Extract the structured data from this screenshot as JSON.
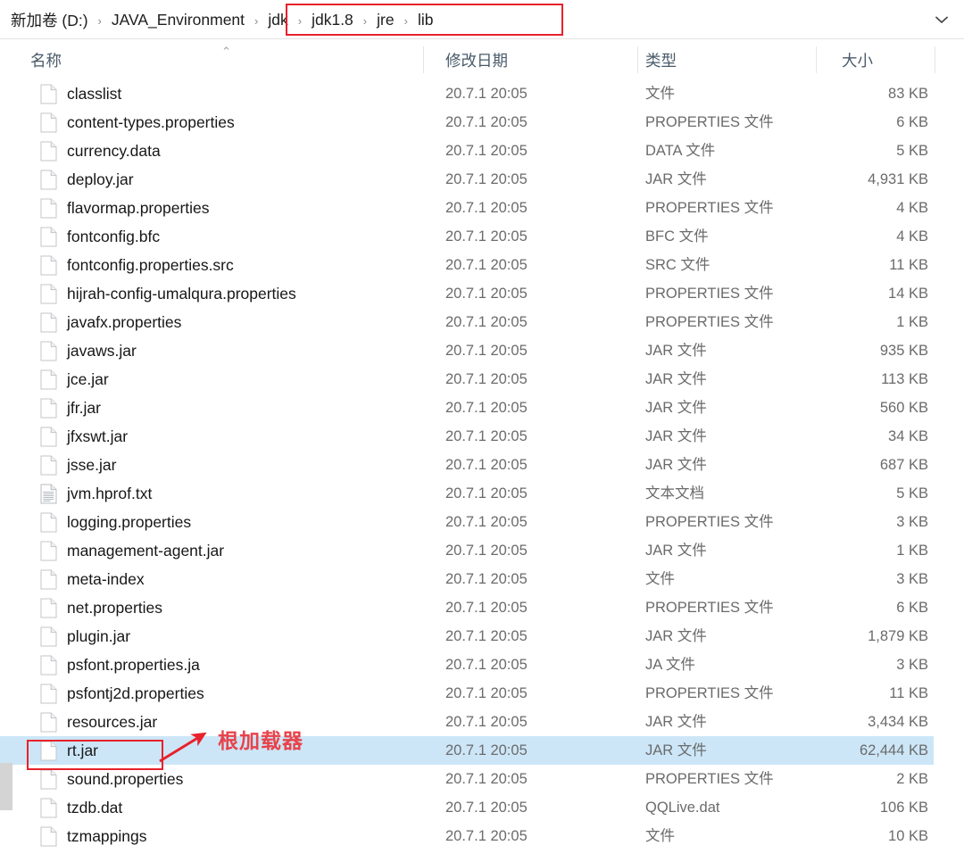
{
  "address_bar": {
    "breadcrumbs": [
      {
        "label": "新加卷 (D:)",
        "highlighted": false
      },
      {
        "label": "JAVA_Environment",
        "highlighted": false
      },
      {
        "label": "jdk",
        "highlighted": true
      },
      {
        "label": "jdk1.8",
        "highlighted": true
      },
      {
        "label": "jre",
        "highlighted": true
      },
      {
        "label": "lib",
        "highlighted": true
      }
    ],
    "separator": "›",
    "dropdown_icon": "chevron-down-icon",
    "highlight_color": "#e8212b"
  },
  "columns": {
    "name": "名称",
    "date_modified": "修改日期",
    "type": "类型",
    "size": "大小",
    "sort_indicator": "⌃",
    "sort_column": "名称",
    "sort_direction": "ascending"
  },
  "annotation": {
    "text": "根加载器",
    "color": "#e8434b",
    "target": "rt.jar",
    "arrow_icon": "arrow-up-right-icon"
  },
  "selection": {
    "selected_file": "rt.jar",
    "highlight_color": "#cce6f7"
  },
  "files": [
    {
      "icon": "blank-file-icon",
      "name": "classlist",
      "date": "20.7.1 20:05",
      "type": "文件",
      "size": "83 KB"
    },
    {
      "icon": "blank-file-icon",
      "name": "content-types.properties",
      "date": "20.7.1 20:05",
      "type": "PROPERTIES 文件",
      "size": "6 KB"
    },
    {
      "icon": "blank-file-icon",
      "name": "currency.data",
      "date": "20.7.1 20:05",
      "type": "DATA 文件",
      "size": "5 KB"
    },
    {
      "icon": "blank-file-icon",
      "name": "deploy.jar",
      "date": "20.7.1 20:05",
      "type": "JAR 文件",
      "size": "4,931 KB"
    },
    {
      "icon": "blank-file-icon",
      "name": "flavormap.properties",
      "date": "20.7.1 20:05",
      "type": "PROPERTIES 文件",
      "size": "4 KB"
    },
    {
      "icon": "blank-file-icon",
      "name": "fontconfig.bfc",
      "date": "20.7.1 20:05",
      "type": "BFC 文件",
      "size": "4 KB"
    },
    {
      "icon": "blank-file-icon",
      "name": "fontconfig.properties.src",
      "date": "20.7.1 20:05",
      "type": "SRC 文件",
      "size": "11 KB"
    },
    {
      "icon": "blank-file-icon",
      "name": "hijrah-config-umalqura.properties",
      "date": "20.7.1 20:05",
      "type": "PROPERTIES 文件",
      "size": "14 KB"
    },
    {
      "icon": "blank-file-icon",
      "name": "javafx.properties",
      "date": "20.7.1 20:05",
      "type": "PROPERTIES 文件",
      "size": "1 KB"
    },
    {
      "icon": "blank-file-icon",
      "name": "javaws.jar",
      "date": "20.7.1 20:05",
      "type": "JAR 文件",
      "size": "935 KB"
    },
    {
      "icon": "blank-file-icon",
      "name": "jce.jar",
      "date": "20.7.1 20:05",
      "type": "JAR 文件",
      "size": "113 KB"
    },
    {
      "icon": "blank-file-icon",
      "name": "jfr.jar",
      "date": "20.7.1 20:05",
      "type": "JAR 文件",
      "size": "560 KB"
    },
    {
      "icon": "blank-file-icon",
      "name": "jfxswt.jar",
      "date": "20.7.1 20:05",
      "type": "JAR 文件",
      "size": "34 KB"
    },
    {
      "icon": "blank-file-icon",
      "name": "jsse.jar",
      "date": "20.7.1 20:05",
      "type": "JAR 文件",
      "size": "687 KB"
    },
    {
      "icon": "text-document-icon",
      "name": "jvm.hprof.txt",
      "date": "20.7.1 20:05",
      "type": "文本文档",
      "size": "5 KB"
    },
    {
      "icon": "blank-file-icon",
      "name": "logging.properties",
      "date": "20.7.1 20:05",
      "type": "PROPERTIES 文件",
      "size": "3 KB"
    },
    {
      "icon": "blank-file-icon",
      "name": "management-agent.jar",
      "date": "20.7.1 20:05",
      "type": "JAR 文件",
      "size": "1 KB"
    },
    {
      "icon": "blank-file-icon",
      "name": "meta-index",
      "date": "20.7.1 20:05",
      "type": "文件",
      "size": "3 KB"
    },
    {
      "icon": "blank-file-icon",
      "name": "net.properties",
      "date": "20.7.1 20:05",
      "type": "PROPERTIES 文件",
      "size": "6 KB"
    },
    {
      "icon": "blank-file-icon",
      "name": "plugin.jar",
      "date": "20.7.1 20:05",
      "type": "JAR 文件",
      "size": "1,879 KB"
    },
    {
      "icon": "blank-file-icon",
      "name": "psfont.properties.ja",
      "date": "20.7.1 20:05",
      "type": "JA 文件",
      "size": "3 KB"
    },
    {
      "icon": "blank-file-icon",
      "name": "psfontj2d.properties",
      "date": "20.7.1 20:05",
      "type": "PROPERTIES 文件",
      "size": "11 KB"
    },
    {
      "icon": "blank-file-icon",
      "name": "resources.jar",
      "date": "20.7.1 20:05",
      "type": "JAR 文件",
      "size": "3,434 KB"
    },
    {
      "icon": "blank-file-icon",
      "name": "rt.jar",
      "date": "20.7.1 20:05",
      "type": "JAR 文件",
      "size": "62,444 KB"
    },
    {
      "icon": "blank-file-icon",
      "name": "sound.properties",
      "date": "20.7.1 20:05",
      "type": "PROPERTIES 文件",
      "size": "2 KB"
    },
    {
      "icon": "blank-file-icon",
      "name": "tzdb.dat",
      "date": "20.7.1 20:05",
      "type": "QQLive.dat",
      "size": "106 KB"
    },
    {
      "icon": "blank-file-icon",
      "name": "tzmappings",
      "date": "20.7.1 20:05",
      "type": "文件",
      "size": "10 KB"
    }
  ]
}
